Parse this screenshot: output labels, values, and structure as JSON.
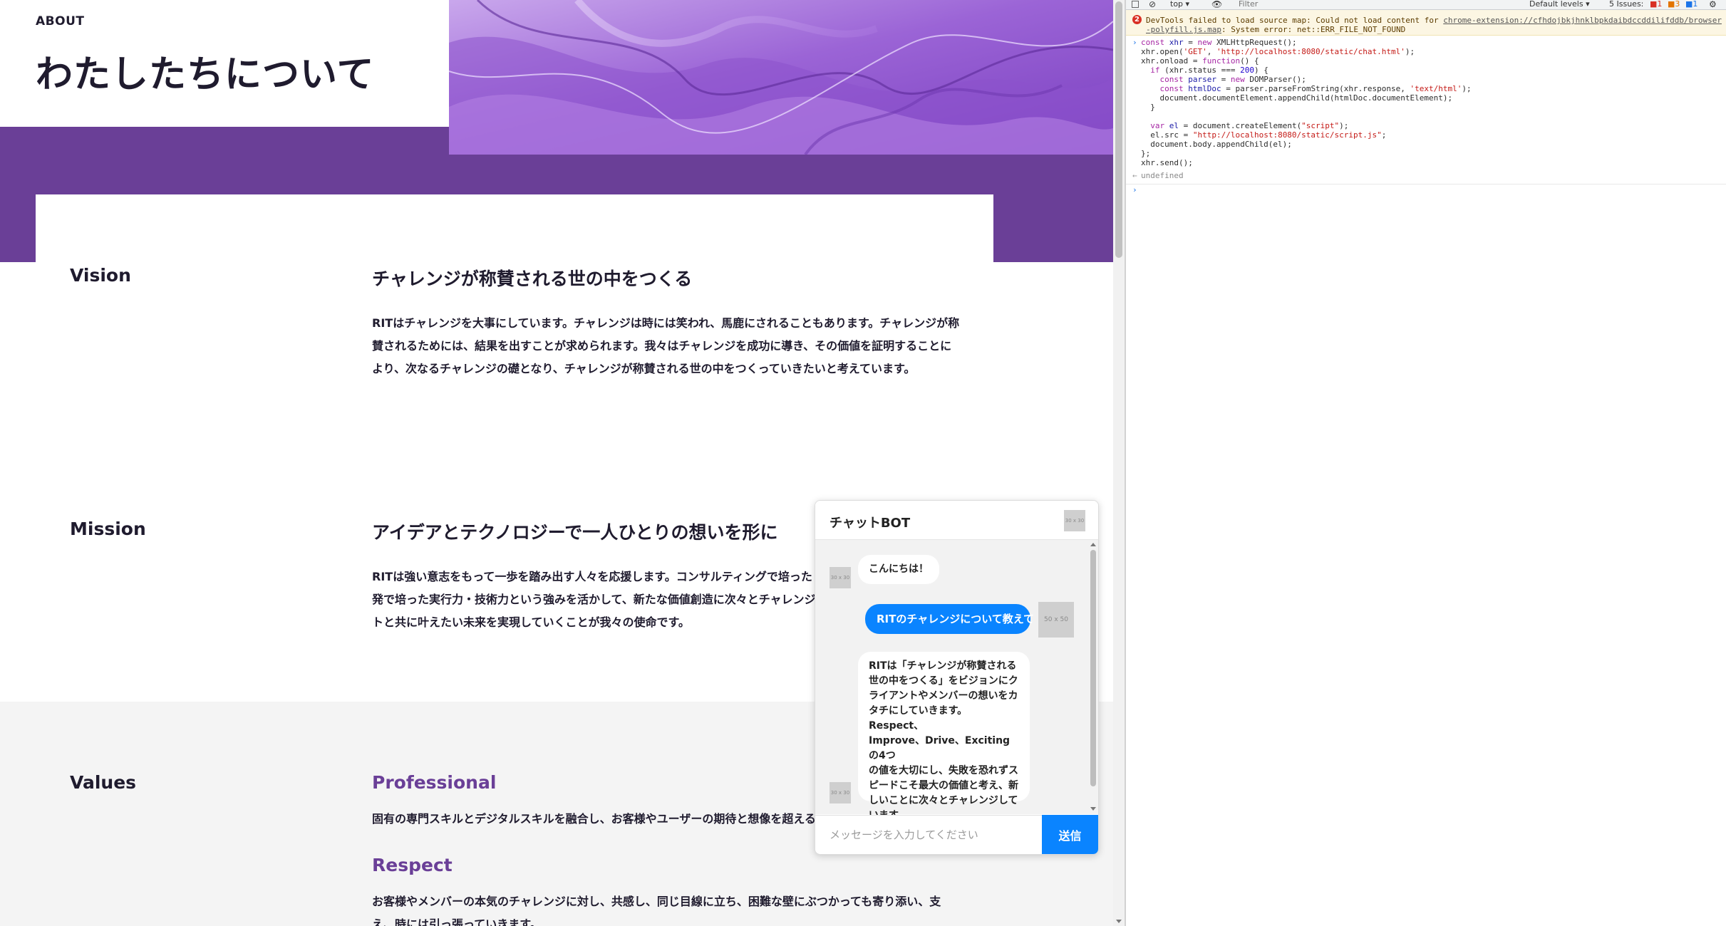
{
  "page": {
    "about_label": "ABOUT",
    "about_title": "わたしたちについて",
    "vision": {
      "label": "Vision",
      "heading": "チャレンジが称賛される世の中をつくる",
      "body": [
        "RITはチャレンジを大事にしています。チャレンジは時には笑われ、馬鹿にされることもあります。チャレンジが称",
        "賛されるためには、結果を出すことが求められます。我々はチャレンジを成功に導き、その価値を証明することに",
        "より、次なるチャレンジの礎となり、チャレンジが称賛される世の中をつくっていきたいと考えています。"
      ]
    },
    "mission": {
      "label": "Mission",
      "heading": "アイデアとテクノロジーで一人ひとりの想いを形に",
      "body": [
        "RITは強い意志をもって一歩を踏み出す人々を応援します。コンサルティングで培った",
        "発で培った実行力・技術力という強みを活かして、新たな価値創造に次々とチャレンジ",
        "トと共に叶えたい未来を実現していくことが我々の使命です。"
      ]
    },
    "values": {
      "label": "Values",
      "professional": {
        "heading": "Professional",
        "body": "固有の専門スキルとデジタルスキルを融合し、お客様やユーザーの期待と想像を超える"
      },
      "respect": {
        "heading": "Respect",
        "body": [
          "お客様やメンバーの本気のチャレンジに対し、共感し、同じ目線に立ち、困難な壁にぶつかっても寄り添い、支",
          "え、時には引っ張っていきます。"
        ]
      }
    }
  },
  "chat": {
    "title": "チャットBOT",
    "header_image_text": "30 x 30",
    "bot_avatar_text": "30 x 30",
    "user_avatar_text": "50 x 50",
    "messages": [
      {
        "sender": "bot",
        "text": "こんにちは！"
      },
      {
        "sender": "user",
        "text": "RITのチャレンジについて教えて"
      },
      {
        "sender": "bot",
        "lines": [
          "RITは「チャレンジが称賛される",
          "世の中をつくる」をビジョンにク",
          "ライアントやメンバーの想いをカ",
          "タチにしていきます。 Respect、",
          "Improve、Drive、Excitingの4つ",
          "の値を大切にし、失敗を恐れずス",
          "ピードこそ最大の価値と考え、新",
          "しいことに次々とチャレンジして",
          "います。"
        ]
      }
    ],
    "input_placeholder": "メッセージを入力してください",
    "send_label": "送信"
  },
  "devtools": {
    "toolbar": {
      "context": "top",
      "filter_placeholder": "Filter",
      "levels": "Default levels",
      "issues_label": "5 Issues:",
      "errors": "1",
      "warnings": "3",
      "info": "1"
    },
    "error": {
      "count": "2",
      "line1_prefix": "DevTools failed to load source map: Could not load content for ",
      "line1_link": "chrome-extension://cfhdojbkjhnklbpkdaibdccddilifddb/browser",
      "line2_link": "-polyfill.js.map",
      "line2_suffix": ": System error: net::ERR_FILE_NOT_FOUND"
    },
    "code": [
      "const xhr = new XMLHttpRequest();",
      "xhr.open('GET', 'http://localhost:8080/static/chat.html');",
      "xhr.onload = function() {",
      "  if (xhr.status === 200) {",
      "    const parser = new DOMParser();",
      "    const htmlDoc = parser.parseFromString(xhr.response, 'text/html');",
      "    document.documentElement.appendChild(htmlDoc.documentElement);",
      "  }",
      "",
      "  var el = document.createElement(\"script\");",
      "  el.src = \"http://localhost:8080/static/script.js\";",
      "  document.body.appendChild(el);",
      "};",
      "xhr.send();"
    ],
    "result": "undefined",
    "colors": {
      "keyword": "#a626a4",
      "string": "#c41a16",
      "error_bg": "#fcf6e3"
    }
  },
  "colors": {
    "brand_purple": "#6a3f97",
    "chat_blue": "#0a84ff"
  }
}
